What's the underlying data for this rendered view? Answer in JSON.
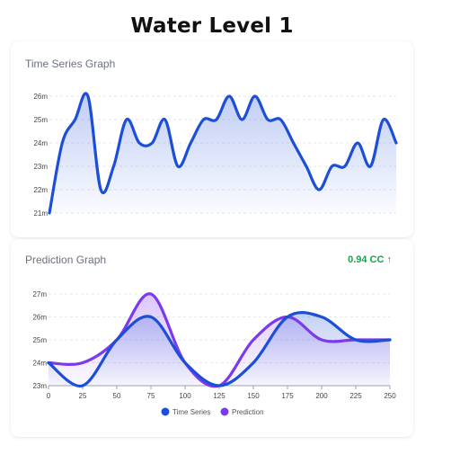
{
  "page": {
    "title": "Water Level 1"
  },
  "time_series_card": {
    "title": "Time Series Graph"
  },
  "prediction_card": {
    "title": "Prediction Graph",
    "metric_value": "0.94 CC",
    "metric_icon": "arrow-up-icon",
    "metric_arrow": "↑"
  },
  "colors": {
    "time_series": "#1d4ed8",
    "prediction": "#7c3aed",
    "metric": "#16a34a"
  },
  "chart_data": [
    {
      "type": "area",
      "title": "Time Series Graph",
      "y_tick_labels": [
        "21m",
        "22m",
        "23m",
        "24m",
        "25m",
        "26m"
      ],
      "ylim": [
        21,
        26
      ],
      "x_axis_labels_visible": false,
      "grid": true,
      "series": [
        {
          "color": "#1d4ed8",
          "values": [
            21,
            24,
            25,
            26,
            22,
            23,
            25,
            24,
            24,
            25,
            23,
            24,
            25,
            25,
            26,
            25,
            26,
            25,
            25,
            24,
            23,
            22,
            23,
            23,
            24,
            23,
            25,
            24
          ]
        }
      ]
    },
    {
      "type": "area",
      "title": "Prediction Graph",
      "x": [
        0,
        25,
        50,
        75,
        100,
        125,
        150,
        175,
        200,
        225,
        250
      ],
      "x_tick_labels": [
        "0",
        "25",
        "50",
        "75",
        "100",
        "125",
        "150",
        "175",
        "200",
        "225",
        "250"
      ],
      "y_tick_labels": [
        "23m",
        "24m",
        "25m",
        "26m",
        "27m"
      ],
      "ylim": [
        23,
        27
      ],
      "grid": true,
      "legend": "bottom-center",
      "series": [
        {
          "name": "Time Series",
          "color": "#1d4ed8",
          "values": [
            24,
            23,
            25,
            26,
            24,
            23,
            24,
            26,
            26,
            25,
            25
          ]
        },
        {
          "name": "Prediction",
          "color": "#7c3aed",
          "values": [
            24,
            24,
            25,
            27,
            24,
            23,
            25,
            26,
            25,
            25,
            25
          ]
        }
      ]
    }
  ]
}
